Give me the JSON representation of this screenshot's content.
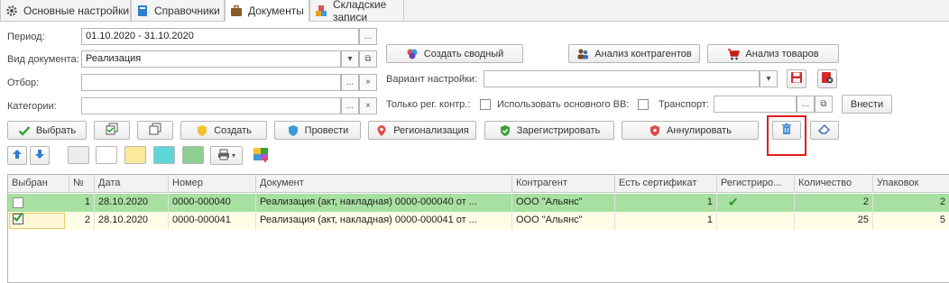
{
  "tabs": [
    {
      "label": "Основные настройки",
      "icon": "gear-icon"
    },
    {
      "label": "Справочники",
      "icon": "book-icon"
    },
    {
      "label": "Документы",
      "icon": "briefcase-icon"
    },
    {
      "label": "Складские записи",
      "icon": "blocks-icon"
    }
  ],
  "form": {
    "period_label": "Период:",
    "period_value": "01.10.2020 - 31.10.2020",
    "doc_type_label": "Вид документа:",
    "doc_type_value": "Реализация",
    "filter_label": "Отбор:",
    "filter_value": "",
    "categories_label": "Категории:",
    "categories_value": "",
    "variant_label": "Вариант настройки:",
    "variant_value": "",
    "only_reg_label": "Только рег. контр.:",
    "use_main_label": "Использовать основного ВВ:",
    "transport_label": "Транспорт:",
    "transport_value": "",
    "ellipsis": "...",
    "clear": "×",
    "open": "⧉",
    "dropdown": "▾"
  },
  "buttons": {
    "create_summary": "Создать сводный",
    "analysis_contractors": "Анализ контрагентов",
    "analysis_goods": "Анализ товаров",
    "apply": "Внести",
    "select": "Выбрать",
    "create": "Создать",
    "post": "Провести",
    "regionalize": "Регионализация",
    "register": "Зарегистрировать",
    "annul": "Аннулировать"
  },
  "colors": {
    "green_row": "#a8e0a1",
    "selected_row": "#fefde6",
    "highlight": "#e41b1b"
  },
  "table": {
    "columns": [
      "Выбран",
      "№",
      "Дата",
      "Номер",
      "Документ",
      "Контрагент",
      "Есть сертификат",
      "Регистриро...",
      "Количество",
      "Упаковок"
    ],
    "rows": [
      {
        "checked": false,
        "num": "1",
        "date": "28.10.2020",
        "number": "0000-000040",
        "document": "Реализация (акт, накладная) 0000-000040 от ...",
        "contractor": "ООО \"Альянс\"",
        "cert": "1",
        "registered": "✔",
        "qty": "2",
        "packs": "2"
      },
      {
        "checked": true,
        "num": "2",
        "date": "28.10.2020",
        "number": "0000-000041",
        "document": "Реализация (акт, накладная) 0000-000041 от ...",
        "contractor": "ООО \"Альянс\"",
        "cert": "1",
        "registered": "",
        "qty": "25",
        "packs": "5"
      }
    ]
  }
}
